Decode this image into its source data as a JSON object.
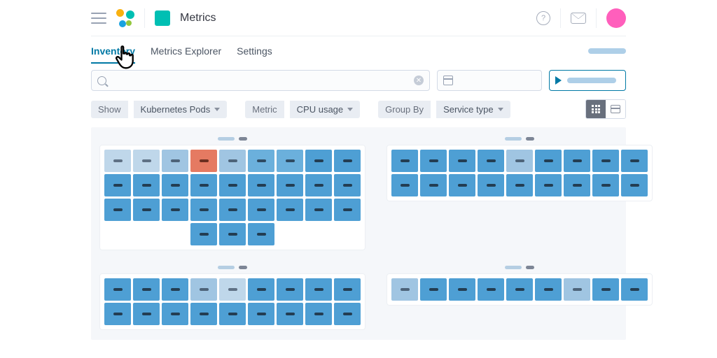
{
  "header": {
    "app_title": "Metrics"
  },
  "tabs": {
    "inventory": "Inventory",
    "explorer": "Metrics Explorer",
    "settings": "Settings"
  },
  "filters": {
    "show_label": "Show",
    "show_value": "Kubernetes Pods",
    "metric_label": "Metric",
    "metric_value": "CPU usage",
    "groupby_label": "Group By",
    "groupby_value": "Service type"
  },
  "grid": {
    "panels": [
      {
        "rows": [
          [
            0,
            0,
            1,
            4,
            1,
            2,
            2,
            3,
            3
          ],
          [
            3,
            3,
            3,
            3,
            3,
            3,
            3,
            3,
            3
          ],
          [
            3,
            3,
            3,
            3,
            3,
            3,
            3,
            3,
            3
          ],
          [
            3,
            3,
            3
          ]
        ]
      },
      {
        "rows": [
          [
            3,
            3,
            3,
            3,
            1,
            3,
            3,
            3,
            3
          ],
          [
            3,
            3,
            3,
            3,
            3,
            3,
            3,
            3,
            3
          ]
        ]
      },
      {
        "rows": [
          [
            3,
            3,
            3,
            1,
            0,
            3,
            3,
            3,
            3
          ],
          [
            3,
            3,
            3,
            3,
            3,
            3,
            3,
            3,
            3
          ]
        ]
      },
      {
        "rows": [
          [
            1,
            3,
            3,
            3,
            3,
            3,
            1,
            3,
            3
          ]
        ]
      }
    ]
  }
}
